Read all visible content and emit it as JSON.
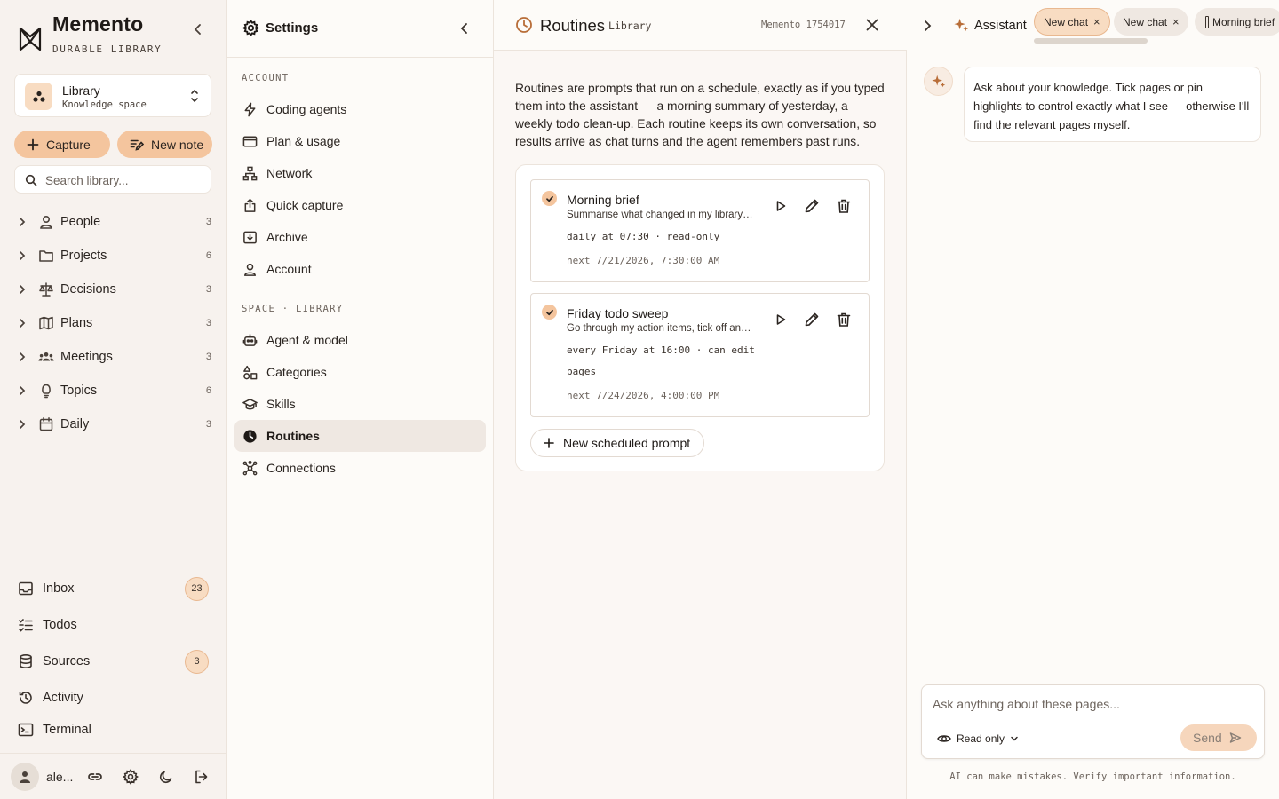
{
  "brand": {
    "title": "Memento",
    "subtitle": "DURABLE LIBRARY"
  },
  "space": {
    "name": "Library",
    "kind": "Knowledge space"
  },
  "actions": {
    "capture": "Capture",
    "new_note": "New note"
  },
  "search": {
    "placeholder": "Search library..."
  },
  "tree": [
    {
      "label": "People",
      "count": "3",
      "icon": "person-icon"
    },
    {
      "label": "Projects",
      "count": "6",
      "icon": "folder-icon"
    },
    {
      "label": "Decisions",
      "count": "3",
      "icon": "scale-icon"
    },
    {
      "label": "Plans",
      "count": "3",
      "icon": "map-icon"
    },
    {
      "label": "Meetings",
      "count": "3",
      "icon": "group-icon"
    },
    {
      "label": "Topics",
      "count": "6",
      "icon": "lightbulb-icon"
    },
    {
      "label": "Daily",
      "count": "3",
      "icon": "calendar-icon"
    }
  ],
  "nav": [
    {
      "label": "Inbox",
      "badge": "23",
      "icon": "inbox-icon"
    },
    {
      "label": "Todos",
      "badge": "",
      "icon": "checklist-icon"
    },
    {
      "label": "Sources",
      "badge": "3",
      "icon": "database-icon"
    },
    {
      "label": "Activity",
      "badge": "",
      "icon": "history-icon"
    },
    {
      "label": "Terminal",
      "badge": "",
      "icon": "terminal-icon"
    }
  ],
  "user": {
    "name": "ale..."
  },
  "settings": {
    "title": "Settings",
    "account_label": "ACCOUNT",
    "account_items": [
      "Coding agents",
      "Plan & usage",
      "Network",
      "Quick capture",
      "Archive",
      "Account"
    ],
    "space_label": "SPACE · LIBRARY",
    "space_items": [
      "Agent & model",
      "Categories",
      "Skills",
      "Routines",
      "Connections"
    ],
    "active_item": "Routines"
  },
  "main": {
    "title": "Routines",
    "context": "Library",
    "version": "Memento 1754017",
    "intro": "Routines are prompts that run on a schedule, exactly as if you typed them into the assistant — a morning summary of yesterday, a weekly todo clean-up. Each routine keeps its own conversation, so results arrive as chat turns and the agent remembers past runs.",
    "routines": [
      {
        "name": "Morning brief",
        "prompt": "Summarise what changed in my library since yesterday",
        "schedule": "daily at 07:30 · read-only",
        "next": "next 7/21/2026, 7:30:00 AM",
        "enabled": true
      },
      {
        "name": "Friday todo sweep",
        "prompt": "Go through my action items, tick off anything that is done",
        "schedule": "every Friday at 16:00 · can edit pages",
        "next": "next 7/24/2026, 4:00:00 PM",
        "enabled": true
      }
    ],
    "new_button": "New scheduled prompt"
  },
  "assistant": {
    "title": "Assistant",
    "tabs": [
      {
        "label": "New chat",
        "active": true
      },
      {
        "label": "New chat",
        "active": false
      },
      {
        "label": "Morning brief",
        "active": false
      }
    ],
    "message": "Ask about your knowledge. Tick pages or pin highlights to control exactly what I see — otherwise I'll find the relevant pages myself.",
    "input_placeholder": "Ask anything about these pages...",
    "mode": "Read only",
    "send": "Send",
    "disclaimer": "AI can make mistakes. Verify important information."
  },
  "colors": {
    "accent": "#f4c59e",
    "accent_soft": "#f8dcc2",
    "brand_icon": "#b86d38"
  }
}
